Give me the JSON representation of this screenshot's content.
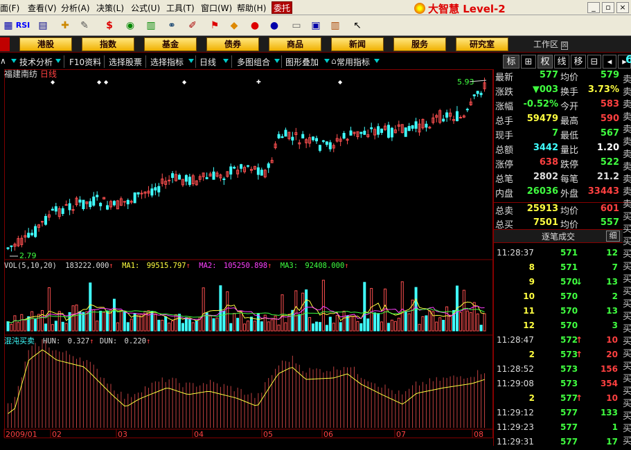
{
  "menu": {
    "items": [
      "面(F)",
      "查看(V)",
      "分析(A)",
      "决策(L)",
      "公式(U)",
      "工具(T)",
      "窗口(W)",
      "帮助(H)"
    ],
    "trust_button": "委托",
    "brand": "大智慧 Level-2"
  },
  "navbar": {
    "items": [
      "港股",
      "指数",
      "基金",
      "债券",
      "商品",
      "新闻",
      "服务",
      "研究室"
    ],
    "workspace": "工作区"
  },
  "funcbar": {
    "items": [
      "技术分析",
      "F10资料",
      "选择股票",
      "选择指标",
      "日线",
      "多图组合",
      "图形叠加",
      "常用指标"
    ],
    "right_tabs": [
      "标",
      "权",
      "线",
      "移"
    ]
  },
  "chart": {
    "stock_name": "福建南纺",
    "period": "日线",
    "price_high_label": "5.93",
    "price_low_label": "2.79",
    "vol_label": "VOL(5,10,20)",
    "vol_value": "183222.000",
    "ma1_label": "MA1:",
    "ma1_value": "99515.797",
    "ma2_label": "MA2:",
    "ma2_value": "105250.898",
    "ma3_label": "MA3:",
    "ma3_value": "92408.000",
    "ind_name": "混沌买卖",
    "hun_label": "HUN:",
    "hun_value": "0.327",
    "dun_label": "DUN:",
    "dun_value": "0.220",
    "x_labels": [
      "2009/01",
      "02",
      "03",
      "04",
      "05",
      "06",
      "07",
      "08"
    ],
    "colors": {
      "up": "#ff5050",
      "down": "#40ffff",
      "ma1": "#ffff40",
      "ma2": "#ff40ff",
      "ma3": "#40ff40",
      "grid": "#800000"
    }
  },
  "chart_data": {
    "type": "candlestick",
    "price_range": [
      2.79,
      5.93
    ],
    "series": [
      {
        "name": "MA1"
      },
      {
        "name": "MA2"
      },
      {
        "name": "MA3"
      },
      {
        "name": "HUN"
      },
      {
        "name": "DUN"
      }
    ]
  },
  "quote": {
    "rows": [
      {
        "k1": "最新",
        "v1": "577",
        "c1": "#40ff40",
        "k2": "均价",
        "v2": "579",
        "c2": "#40ff40"
      },
      {
        "k1": "涨跌",
        "v1": "▼003",
        "c1": "#40ff40",
        "k2": "换手",
        "v2": "3.73%",
        "c2": "#ffff40"
      },
      {
        "k1": "涨幅",
        "v1": "-0.52%",
        "c1": "#40ff40",
        "k2": "今开",
        "v2": "583",
        "c2": "#ff4040"
      },
      {
        "k1": "总手",
        "v1": "59479",
        "c1": "#ffff40",
        "k2": "最高",
        "v2": "590",
        "c2": "#ff4040"
      },
      {
        "k1": "现手",
        "v1": "7",
        "c1": "#40ff40",
        "k2": "最低",
        "v2": "567",
        "c2": "#40ff40"
      },
      {
        "k1": "总额",
        "v1": "3442",
        "c1": "#40ffff",
        "k2": "量比",
        "v2": "1.20",
        "c2": "#ffffff"
      },
      {
        "k1": "涨停",
        "v1": "638",
        "c1": "#ff4040",
        "k2": "跌停",
        "v2": "522",
        "c2": "#40ff40"
      },
      {
        "k1": "总笔",
        "v1": "2802",
        "c1": "#dddddd",
        "k2": "每笔",
        "v2": "21.2",
        "c2": "#dddddd"
      },
      {
        "k1": "内盘",
        "v1": "26036",
        "c1": "#40ff40",
        "k2": "外盘",
        "v2": "33443",
        "c2": "#ff4040"
      },
      {
        "k1": "总卖",
        "v1": "25913",
        "c1": "#ffff40",
        "k2": "均价",
        "v2": "601",
        "c2": "#ff4040"
      },
      {
        "k1": "总买",
        "v1": "7501",
        "c1": "#ffff40",
        "k2": "均价",
        "v2": "557",
        "c2": "#40ff40"
      }
    ],
    "trades_header": "逐笔成交",
    "trades_tab": "细",
    "trades": [
      {
        "t": "11:28:37",
        "p": "571",
        "a": "",
        "v": "12"
      },
      {
        "t": "8",
        "p": "571",
        "a": "",
        "v": "7"
      },
      {
        "t": "9",
        "p": "570",
        "a": "↓",
        "v": "13"
      },
      {
        "t": "10",
        "p": "570",
        "a": "",
        "v": "2"
      },
      {
        "t": "11",
        "p": "570",
        "a": "",
        "v": "13"
      },
      {
        "t": "12",
        "p": "570",
        "a": "",
        "v": "3"
      },
      {
        "t": "11:28:47",
        "p": "572",
        "a": "↑",
        "v": "10"
      },
      {
        "t": "2",
        "p": "573",
        "a": "↑",
        "v": "20"
      },
      {
        "t": "11:28:52",
        "p": "573",
        "a": "",
        "v": "156"
      },
      {
        "t": "11:29:08",
        "p": "573",
        "a": "",
        "v": "354"
      },
      {
        "t": "2",
        "p": "577",
        "a": "↑",
        "v": "10"
      },
      {
        "t": "11:29:12",
        "p": "577",
        "a": "",
        "v": "133"
      },
      {
        "t": "11:29:23",
        "p": "577",
        "a": "",
        "v": "1"
      },
      {
        "t": "11:29:31",
        "p": "577",
        "a": "",
        "v": "17"
      }
    ],
    "edge": [
      "卖",
      "卖",
      "卖",
      "卖",
      "卖",
      "卖",
      "卖",
      "卖",
      "卖",
      "卖",
      "卖",
      "买",
      "买",
      "买",
      "买",
      "买",
      "买",
      "买",
      "买",
      "买",
      "买",
      "买",
      "买",
      "买",
      "买",
      "买",
      "买",
      "买",
      "买",
      "买"
    ],
    "edge_top": "6"
  }
}
